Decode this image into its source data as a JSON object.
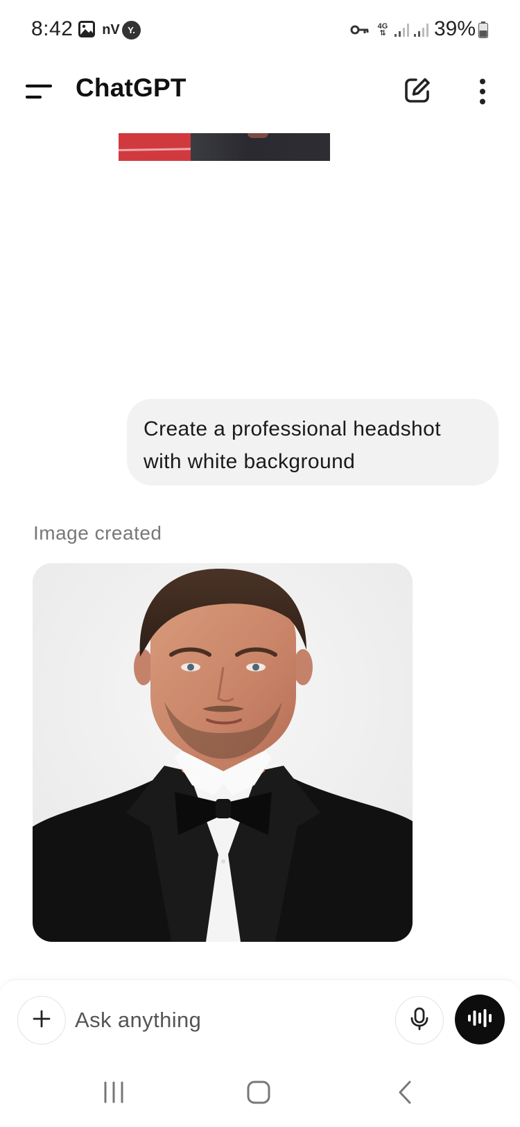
{
  "status_bar": {
    "time": "8:42",
    "carrier_badge": "nV",
    "circle_badge": "Y.",
    "network_type": "4G",
    "battery_percent": "39%",
    "icons": [
      "gallery-icon",
      "key-icon",
      "signal-icon",
      "signal-icon",
      "battery-icon"
    ]
  },
  "header": {
    "title": "ChatGPT",
    "icons": [
      "menu-icon",
      "new-chat-icon",
      "more-vertical-icon"
    ]
  },
  "chat": {
    "user_message": {
      "line1": "Create a professional headshot",
      "line2": "with white background"
    },
    "assistant": {
      "label": "Image created"
    }
  },
  "composer": {
    "placeholder": "Ask anything",
    "icons": [
      "plus-icon",
      "mic-icon",
      "voice-mode-icon"
    ]
  },
  "navigation": {
    "icons": [
      "recents-icon",
      "home-icon",
      "back-icon"
    ]
  },
  "colors": {
    "accent_dark": "#0d0d0d",
    "bubble_bg": "#f2f2f2",
    "label_gray": "#777777"
  }
}
